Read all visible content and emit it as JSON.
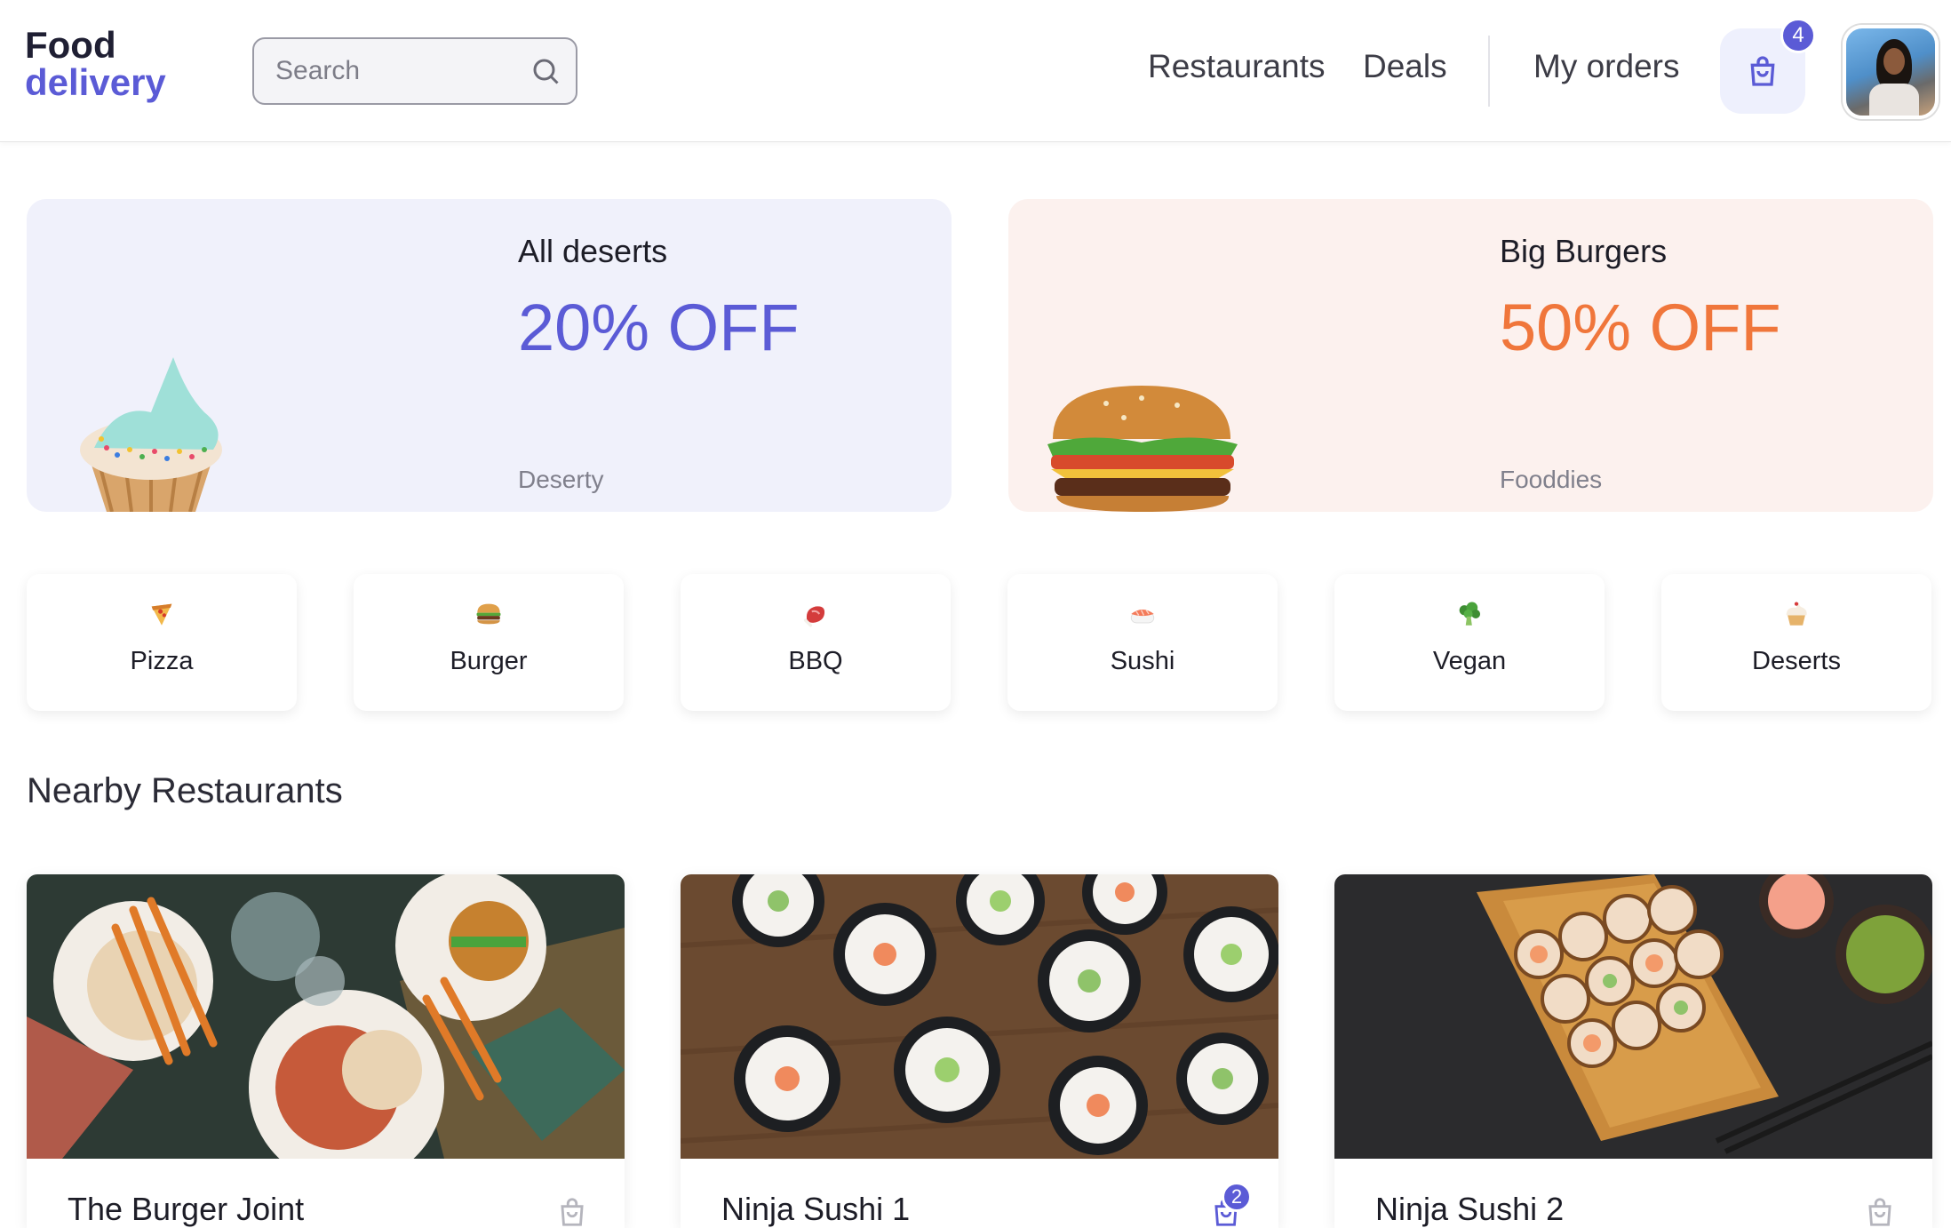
{
  "header": {
    "logo_line1": "Food",
    "logo_line2": "delivery",
    "search_placeholder": "Search",
    "nav": {
      "restaurants": "Restaurants",
      "deals": "Deals",
      "my_orders": "My orders"
    },
    "cart_count": "4"
  },
  "promos": [
    {
      "title": "All deserts",
      "offer": "20% OFF",
      "brand": "Deserty",
      "accent": "#5b5bd6",
      "bg": "#f0f1fb"
    },
    {
      "title": "Big Burgers",
      "offer": "50% OFF",
      "brand": "Fooddies",
      "accent": "#f0763b",
      "bg": "#fcf1ee"
    }
  ],
  "categories": [
    {
      "label": "Pizza",
      "icon": "pizza-icon"
    },
    {
      "label": "Burger",
      "icon": "burger-icon"
    },
    {
      "label": "BBQ",
      "icon": "bbq-icon"
    },
    {
      "label": "Sushi",
      "icon": "sushi-icon"
    },
    {
      "label": "Vegan",
      "icon": "broccoli-icon"
    },
    {
      "label": "Deserts",
      "icon": "cupcake-icon"
    }
  ],
  "section_title": "Nearby Restaurants",
  "restaurants": [
    {
      "name": "The Burger Joint",
      "cart_count": ""
    },
    {
      "name": "Ninja Sushi 1",
      "cart_count": "2"
    },
    {
      "name": "Ninja Sushi 2",
      "cart_count": ""
    }
  ],
  "colors": {
    "primary": "#5b5bd6",
    "orange": "#f0763b"
  }
}
